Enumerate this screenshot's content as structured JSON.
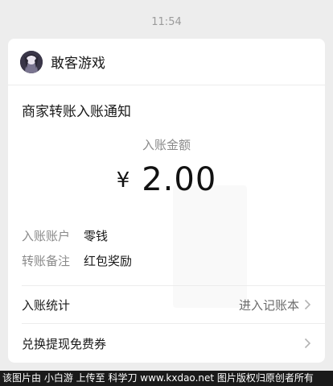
{
  "timestamp": "11:54",
  "message": {
    "sender": "敢客游戏",
    "title": "商家转账入账通知",
    "amount_label": "入账金额",
    "currency_symbol": "¥",
    "amount": "2.00",
    "details": [
      {
        "key": "入账账户",
        "value": "零钱"
      },
      {
        "key": "转账备注",
        "value": "红包奖励"
      }
    ],
    "actions": [
      {
        "label": "入账统计",
        "hint": "进入记账本"
      },
      {
        "label": "兑换提现免费券",
        "hint": ""
      }
    ]
  },
  "footer": {
    "text": "该图片由 小白游 上传至 科学刀 www.kxdao.net 图片版权归原创者所有"
  },
  "icons": {
    "avatar": "avatar-image",
    "chevron": "chevron-right-icon"
  },
  "colors": {
    "background": "#ededed",
    "card": "#ffffff",
    "muted_text": "#8a8a8a"
  }
}
